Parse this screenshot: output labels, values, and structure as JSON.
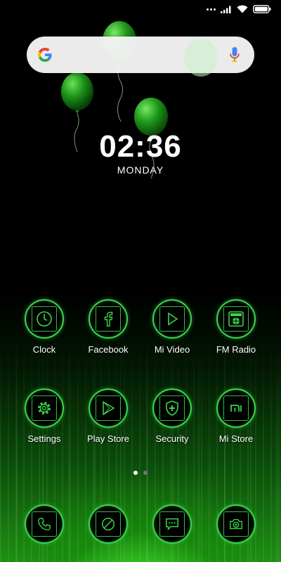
{
  "colors": {
    "accent": "#38d64a",
    "glow": "#1f8f14"
  },
  "status_bar": {
    "icons": [
      "more-dots-icon",
      "signal-icon",
      "wifi-icon",
      "battery-icon"
    ]
  },
  "search": {
    "logo": "google-g-icon",
    "mic": "mic-icon"
  },
  "clock": {
    "time": "02:36",
    "day": "MONDAY"
  },
  "apps": [
    {
      "label": "Clock",
      "icon": "clock-icon"
    },
    {
      "label": "Facebook",
      "icon": "facebook-icon"
    },
    {
      "label": "Mi Video",
      "icon": "play-icon"
    },
    {
      "label": "FM Radio",
      "icon": "radio-icon"
    },
    {
      "label": "Settings",
      "icon": "gear-icon"
    },
    {
      "label": "Play Store",
      "icon": "play-store-icon"
    },
    {
      "label": "Security",
      "icon": "shield-icon"
    },
    {
      "label": "Mi Store",
      "icon": "mi-store-icon"
    }
  ],
  "pager": {
    "pages": 2,
    "active": 1
  },
  "dock": [
    {
      "icon": "phone-icon"
    },
    {
      "icon": "browser-icon"
    },
    {
      "icon": "messages-icon"
    },
    {
      "icon": "camera-icon"
    }
  ]
}
